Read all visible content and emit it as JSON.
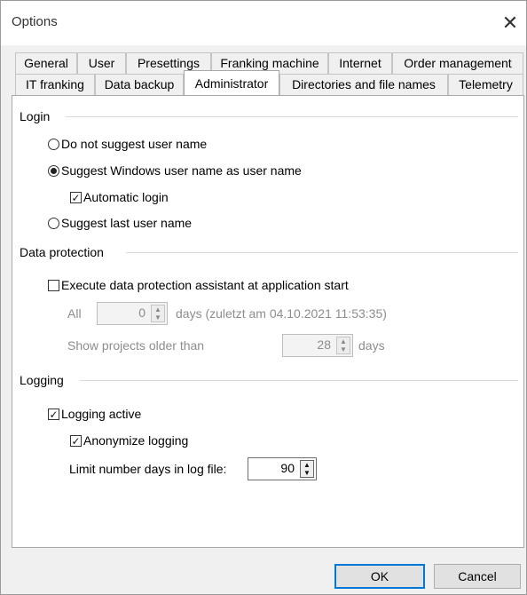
{
  "window": {
    "title": "Options"
  },
  "tabs": {
    "row1": [
      "General",
      "User",
      "Presettings",
      "Franking machine",
      "Internet",
      "Order management"
    ],
    "row2": [
      "IT franking",
      "Data backup",
      "Administrator",
      "Directories and file names",
      "Telemetry"
    ],
    "active": "Administrator"
  },
  "login": {
    "title": "Login",
    "opt1": "Do not suggest user name",
    "opt2": "Suggest Windows user name as user name",
    "auto_login": "Automatic login",
    "opt3": "Suggest last user name"
  },
  "data_protection": {
    "title": "Data protection",
    "assistant": "Execute data protection assistant at application start",
    "all_label": "All",
    "all_value": "0",
    "days_note": "days (zuletzt am 04.10.2021 11:53:35)",
    "older_label": "Show projects older than",
    "older_value": "28",
    "older_unit": "days"
  },
  "logging": {
    "title": "Logging",
    "active": "Logging active",
    "anonymize": "Anonymize logging",
    "limit_label": "Limit number days in log file:",
    "limit_value": "90"
  },
  "buttons": {
    "ok": "OK",
    "cancel": "Cancel"
  }
}
